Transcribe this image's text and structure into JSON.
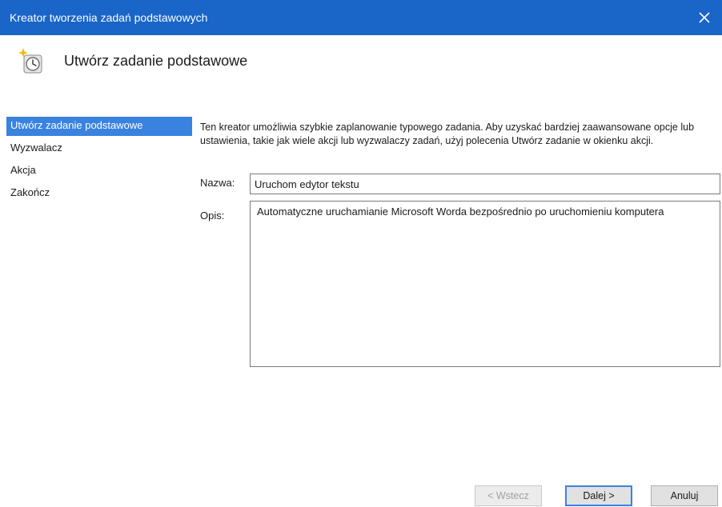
{
  "window": {
    "title": "Kreator tworzenia zadań podstawowych",
    "close_glyph": "✕"
  },
  "header": {
    "title": "Utwórz zadanie podstawowe",
    "icon": "task-clock-icon"
  },
  "steps": [
    {
      "label": "Utwórz zadanie podstawowe",
      "active": true
    },
    {
      "label": "Wyzwalacz",
      "active": false
    },
    {
      "label": "Akcja",
      "active": false
    },
    {
      "label": "Zakończ",
      "active": false
    }
  ],
  "main": {
    "description": "Ten kreator umożliwia szybkie zaplanowanie typowego zadania. Aby uzyskać bardziej zaawansowane opcje lub ustawienia, takie jak wiele akcji lub wyzwalaczy zadań, użyj polecenia Utwórz zadanie w okienku akcji.",
    "name_label": "Nazwa:",
    "name_value": "Uruchom edytor tekstu",
    "desc_label": "Opis:",
    "desc_value": "Automatyczne uruchamianie Microsoft Worda bezpośrednio po uruchomieniu komputera"
  },
  "buttons": {
    "back": "< Wstecz",
    "next": "Dalej >",
    "cancel": "Anuluj"
  },
  "colors": {
    "titlebar": "#1a65c8",
    "accent": "#3a82e0"
  }
}
